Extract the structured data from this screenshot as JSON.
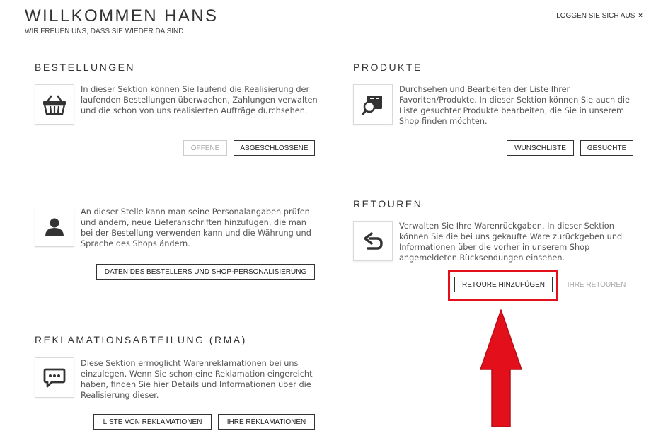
{
  "header": {
    "title": "WILLKOMMEN HANS",
    "subtitle": "WIR FREUEN UNS, DASS SIE WIEDER DA SIND",
    "logout_label": "LOGGEN SIE SICH AUS",
    "logout_icon": "×"
  },
  "sections": {
    "orders": {
      "title": "BESTELLUNGEN",
      "icon": "basket-icon",
      "description": "In dieser Sektion können Sie laufend die Realisierung der laufenden Bestellungen überwachen, Zahlungen verwalten und die schon von uns realisierten Aufträge durchsehen.",
      "buttons": {
        "open": "OFFENE",
        "closed": "ABGESCHLOSSENE"
      }
    },
    "products": {
      "title": "PRODUKTE",
      "icon": "product-search-icon",
      "description": "Durchsehen und Bearbeiten der Liste Ihrer Favoriten/Produkte. In dieser Sektion können Sie auch die Liste gesuchter Produkte bearbeiten, die Sie in unserem Shop finden möchten.",
      "buttons": {
        "wishlist": "WUNSCHLISTE",
        "searched": "GESUCHTE"
      }
    },
    "personal": {
      "icon": "user-icon",
      "description": "An dieser Stelle kann man seine Personalangaben prüfen und ändern, neue Lieferanschriften hinzufügen, die man bei der Bestellung verwenden kann und die Währung und Sprache des Shops ändern.",
      "buttons": {
        "customer_data": "DATEN DES BESTELLERS UND SHOP-PERSONALISIERUNG"
      }
    },
    "returns": {
      "title": "RETOUREN",
      "icon": "return-arrow-icon",
      "description": "Verwalten Sie Ihre Warenrückgaben. In dieser Sektion können Sie die bei uns gekaufte Ware zurückgeben und Informationen über die vorher in unserem Shop angemeldeten Rücksendungen einsehen.",
      "buttons": {
        "add_return": "RETOURE HINZUFÜGEN",
        "your_returns": "IHRE RETOUREN"
      }
    },
    "rma": {
      "title": "REKLAMATIONSABTEILUNG (RMA)",
      "icon": "chat-bubble-icon",
      "description": "Diese Sektion ermöglicht Warenreklamationen bei uns einzulegen. Wenn Sie schon eine Reklamation eingereicht haben, finden Sie hier Details und Informationen über die Realisierung dieser.",
      "buttons": {
        "complaint_list": "LISTE VON REKLAMATIONEN",
        "your_complaints": "IHRE REKLAMATIONEN"
      }
    }
  },
  "annotation": {
    "highlight_color": "#e3101c",
    "arrow_color": "#e3101c",
    "arrow_direction": "up"
  },
  "colors": {
    "text": "#333333",
    "border": "#333333",
    "disabled": "#aaaaaa",
    "icon": "#333333"
  }
}
